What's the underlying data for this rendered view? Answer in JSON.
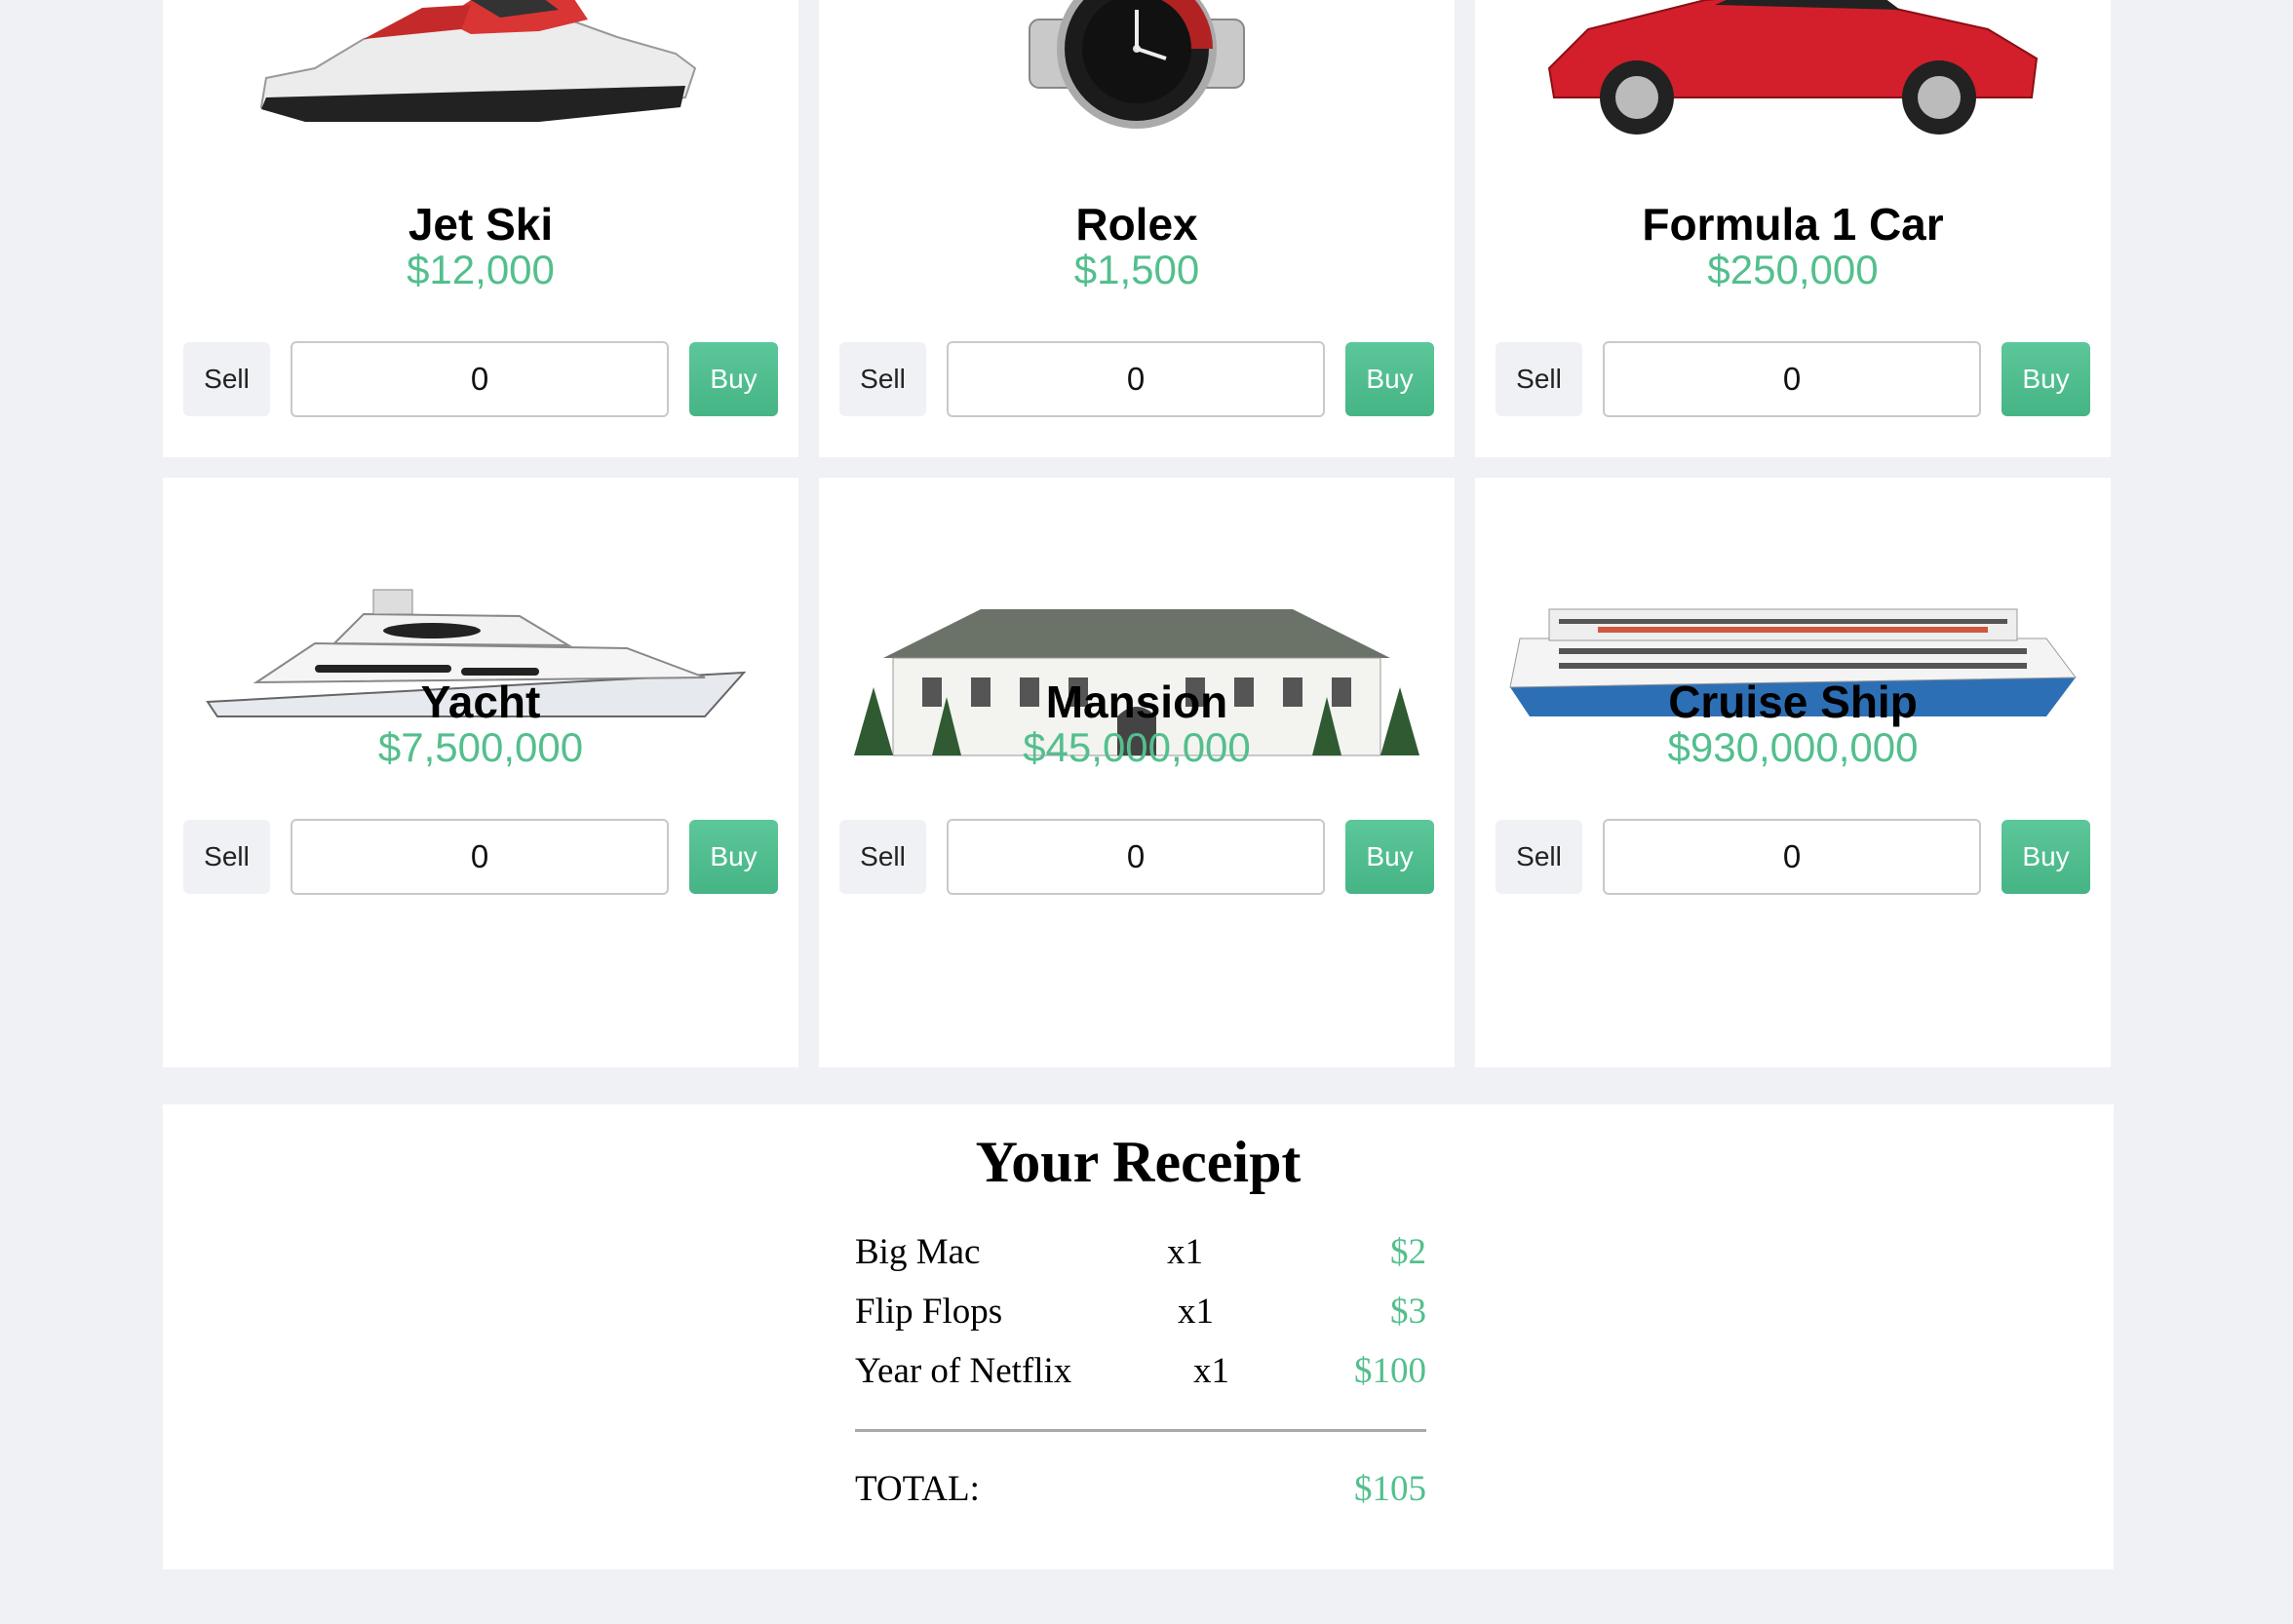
{
  "products": [
    {
      "name": "Jet Ski",
      "price": "$12,000",
      "quantity": "0",
      "sell_label": "Sell",
      "buy_label": "Buy",
      "icon": "jet-ski-image"
    },
    {
      "name": "Rolex",
      "price": "$1,500",
      "quantity": "0",
      "sell_label": "Sell",
      "buy_label": "Buy",
      "icon": "rolex-watch-image"
    },
    {
      "name": "Formula 1 Car",
      "price": "$250,000",
      "quantity": "0",
      "sell_label": "Sell",
      "buy_label": "Buy",
      "icon": "red-sports-car-image"
    },
    {
      "name": "Yacht",
      "price": "$7,500,000",
      "quantity": "0",
      "sell_label": "Sell",
      "buy_label": "Buy",
      "icon": "yacht-image"
    },
    {
      "name": "Mansion",
      "price": "$45,000,000",
      "quantity": "0",
      "sell_label": "Sell",
      "buy_label": "Buy",
      "icon": "mansion-image"
    },
    {
      "name": "Cruise Ship",
      "price": "$930,000,000",
      "quantity": "0",
      "sell_label": "Sell",
      "buy_label": "Buy",
      "icon": "cruise-ship-image"
    }
  ],
  "receipt": {
    "title": "Your Receipt",
    "items": [
      {
        "name": "Big Mac",
        "qty": "x1",
        "amount": "$2"
      },
      {
        "name": "Flip Flops",
        "qty": "x1",
        "amount": "$3"
      },
      {
        "name": "Year of Netflix",
        "qty": "x1",
        "amount": "$100"
      }
    ],
    "total_label": "TOTAL:",
    "total_amount": "$105"
  },
  "colors": {
    "background": "#f0f1f5",
    "price_green": "#53bf8d",
    "buy_button": "#4fbd8c",
    "sell_button": "#f0f1f5"
  }
}
